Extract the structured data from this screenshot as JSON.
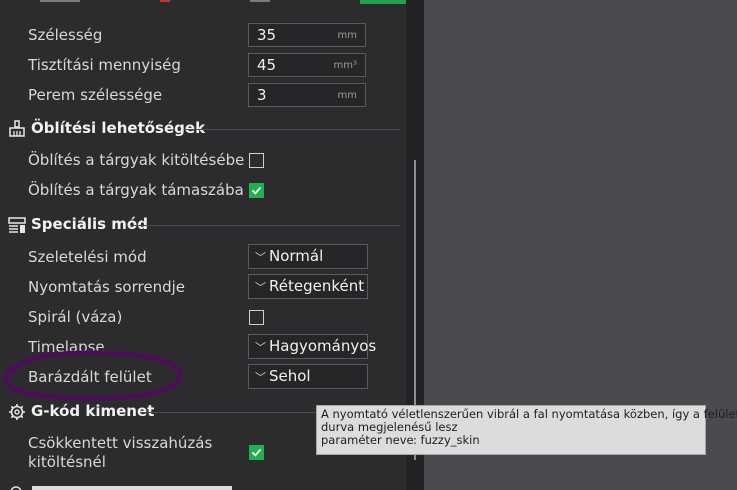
{
  "params": {
    "width": {
      "label": "Szélesség",
      "value": "35",
      "unit": "mm"
    },
    "purge_volume": {
      "label": "Tisztítási mennyiség",
      "value": "45",
      "unit": "mm³"
    },
    "brim_width": {
      "label": "Perem szélessége",
      "value": "3",
      "unit": "mm"
    }
  },
  "sections": {
    "flush": {
      "title": "Öblítési lehetőségek",
      "icon": "broom-icon",
      "items": [
        {
          "label": "Öblítés a tárgyak kitöltésébe",
          "checked": false
        },
        {
          "label": "Öblítés a tárgyak támaszába",
          "checked": true
        }
      ]
    },
    "special": {
      "title": "Speciális mód",
      "icon": "layers-icon",
      "slicing_mode": {
        "label": "Szeletelési mód",
        "value": "Normál"
      },
      "print_sequence": {
        "label": "Nyomtatás sorrendje",
        "value": "Rétegenként"
      },
      "spiral": {
        "label": "Spirál (váza)",
        "checked": false
      },
      "timelapse": {
        "label": "Timelapse",
        "value": "Hagyományos"
      },
      "fuzzy": {
        "label": "Barázdált felület",
        "value": "Sehol"
      }
    },
    "gcode": {
      "title": "G-kód kimenet",
      "icon": "gear-icon",
      "reduce_retract": {
        "label_line1": "Csökkentett visszahúzás",
        "label_line2": "kitöltésnél",
        "checked": true
      }
    }
  },
  "tooltip": {
    "line1": "A nyomtató véletlenszerűen vibrál a fal nyomtatása közben, így a felület",
    "line2": "durva megjelenésű lesz",
    "param_key": "paraméter neve",
    "param_value": ": fuzzy_skin"
  },
  "colors": {
    "accent": "#22b04e",
    "panel_bg": "#2c2c2e",
    "viewport_bg": "#4b4b4f",
    "annotation": "#4b0f5a"
  }
}
